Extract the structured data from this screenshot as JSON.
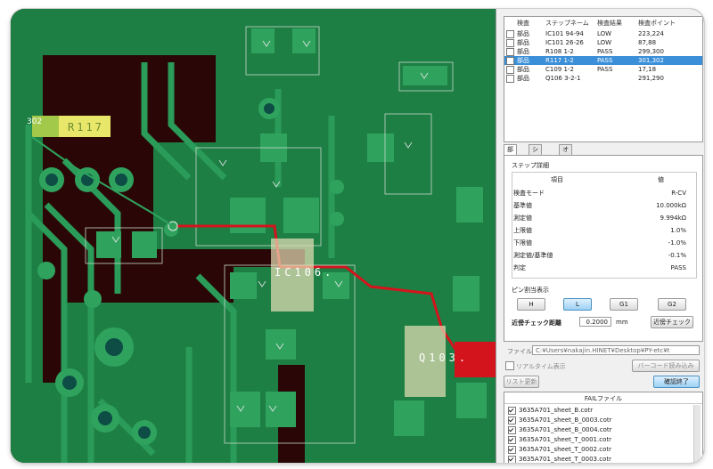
{
  "step_list": {
    "headers": [
      "検査",
      "ステップネーム",
      "検査結果",
      "検査ポイント"
    ],
    "rows": [
      {
        "kind": "部品",
        "step": "IC101 94-94",
        "result": "LOW",
        "point": "223,224",
        "selected": false
      },
      {
        "kind": "部品",
        "step": "IC101 26-26",
        "result": "LOW",
        "point": "87,88",
        "selected": false
      },
      {
        "kind": "部品",
        "step": "R108 1-2",
        "result": "PASS",
        "point": "299,300",
        "selected": false
      },
      {
        "kind": "部品",
        "step": "R117 1-2",
        "result": "PASS",
        "point": "301,302",
        "selected": true
      },
      {
        "kind": "部品",
        "step": "C109 1-2",
        "result": "PASS",
        "point": "17,18",
        "selected": false
      },
      {
        "kind": "部品",
        "step": "Q106 3-2-1",
        "result": "",
        "point": "291,290",
        "selected": false
      }
    ]
  },
  "tabs": [
    "部品",
    "ショート",
    "オープン"
  ],
  "detail": {
    "group_title": "ステップ詳細",
    "col_item": "項目",
    "col_value": "値",
    "rows": [
      {
        "label": "検査モード",
        "value": "R-CV"
      },
      {
        "label": "基準値",
        "value": "10.000kΩ"
      },
      {
        "label": "測定値",
        "value": "9.994kΩ"
      },
      {
        "label": "上限値",
        "value": "1.0%"
      },
      {
        "label": "下限値",
        "value": "-1.0%"
      },
      {
        "label": "測定値/基準値",
        "value": "-0.1%"
      },
      {
        "label": "判定",
        "value": "PASS"
      }
    ],
    "pin_title": "ピン割当表示",
    "pin_buttons": [
      "H",
      "L",
      "G1",
      "G2"
    ],
    "active_pin": "L",
    "near_label": "近傍チェック距離",
    "near_value": "0.2000",
    "near_unit": "mm",
    "near_button": "近傍チェック"
  },
  "file": {
    "label": "ファイル",
    "path": "C:¥Users¥nakajin.HINET¥Desktop¥PY-etc¥t",
    "realtime_label": "リアルタイム表示",
    "barcode_button": "バーコード読み込み",
    "update_button": "リスト更新",
    "finish_button": "確認終了"
  },
  "fail_files": {
    "title": "FAILファイル",
    "items": [
      "3635A701_sheet_B.cotr",
      "3635A701_sheet_B_0003.cotr",
      "3635A701_sheet_B_0004.cotr",
      "3635A701_sheet_T_0001.cotr",
      "3635A701_sheet_T_0002.cotr",
      "3635A701_sheet_T_0003.cotr"
    ]
  },
  "board": {
    "labels": {
      "ref_302": "302",
      "r117": "R117",
      "ic106": "IC106.",
      "q103": "Q103."
    }
  },
  "colors": {
    "copper_green": "#1f8a4a",
    "pad_green": "#2fa35e",
    "substrate": "#2a0706",
    "trace_red": "#d4141d",
    "selection_blue": "#3b8fd8"
  }
}
